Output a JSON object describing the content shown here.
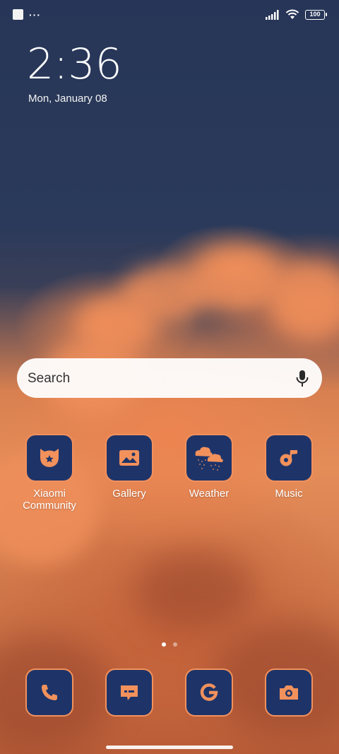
{
  "status_bar": {
    "notification_dots": "···",
    "battery_level": "100"
  },
  "clock": {
    "time": "2:36",
    "date": "Mon, January 08"
  },
  "search": {
    "placeholder": "Search"
  },
  "apps": [
    {
      "label": "Xiaomi Community",
      "icon": "xiaomi-community-icon"
    },
    {
      "label": "Gallery",
      "icon": "gallery-icon"
    },
    {
      "label": "Weather",
      "icon": "weather-icon"
    },
    {
      "label": "Music",
      "icon": "music-icon"
    }
  ],
  "pages": {
    "count": 2,
    "current": 1
  },
  "dock": [
    {
      "icon": "phone-icon"
    },
    {
      "icon": "messages-icon"
    },
    {
      "icon": "google-icon"
    },
    {
      "icon": "camera-icon"
    }
  ],
  "colors": {
    "icon_background": "#1e3469",
    "icon_accent": "#f2915c",
    "sky": "#263656",
    "cloud": "#e58d59"
  }
}
